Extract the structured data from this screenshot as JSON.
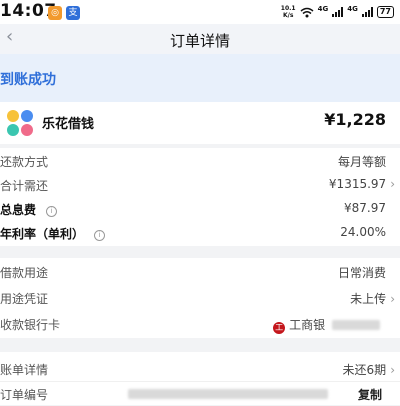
{
  "status_bar": {
    "time": "14:07",
    "net_speed_top": "10.1",
    "net_speed_bottom": "K/s",
    "network1": "4G",
    "network2": "4G",
    "battery": "77"
  },
  "nav": {
    "back_icon": "‹",
    "title": "订单详情"
  },
  "banner": {
    "text": "到账成功"
  },
  "product": {
    "name": "乐花借钱",
    "amount": "¥1,228"
  },
  "repayment": {
    "method_label": "还款方式",
    "method_value": "每月等额",
    "total_label": "合计需还",
    "total_value": "¥1315.97",
    "interest_label": "总息费",
    "interest_value": "¥87.97",
    "rate_label": "年利率（单利）",
    "rate_value": "24.00%"
  },
  "loan": {
    "purpose_label": "借款用途",
    "purpose_value": "日常消费",
    "voucher_label": "用途凭证",
    "voucher_value": "未上传",
    "bank_label": "收款银行卡",
    "bank_logo_glyph": "工",
    "bank_name": "工商银"
  },
  "bill": {
    "detail_label": "账单详情",
    "detail_value": "未还6期",
    "order_no_label": "订单编号",
    "copy_label": "复制"
  },
  "chevron": "›",
  "colors": {
    "accent_blue": "#2f6fd9",
    "banner_bg": "#e8f0fb",
    "bank_red": "#c4161c",
    "page_bg": "#f2f3f5"
  }
}
